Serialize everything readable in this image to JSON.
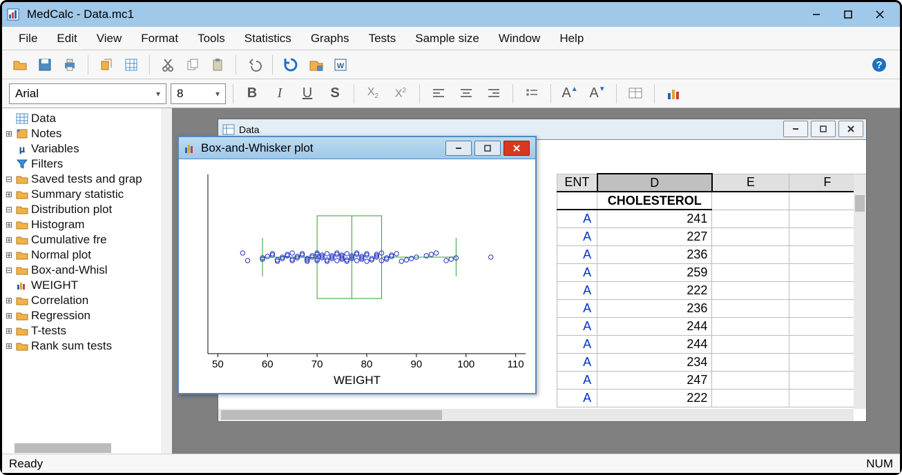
{
  "window": {
    "title": "MedCalc - Data.mc1"
  },
  "menu": [
    "File",
    "Edit",
    "View",
    "Format",
    "Tools",
    "Statistics",
    "Graphs",
    "Tests",
    "Sample size",
    "Window",
    "Help"
  ],
  "font": {
    "name": "Arial",
    "size": "8"
  },
  "tree": {
    "data": "Data",
    "notes": "Notes",
    "variables": "Variables",
    "filters": "Filters",
    "saved": "Saved tests and grap",
    "summary": "Summary statistic",
    "distplot": "Distribution plot",
    "hist": "Histogram",
    "cumfreq": "Cumulative fre",
    "normplot": "Normal plot",
    "boxw": "Box-and-Whisl",
    "weight": "WEIGHT",
    "corr": "Correlation",
    "regr": "Regression",
    "ttests": "T-tests",
    "ranksum": "Rank sum tests"
  },
  "datawin": {
    "title": "Data"
  },
  "sheet": {
    "cols": {
      "c_partial": "ENT",
      "d": "D",
      "e": "E",
      "f": "F"
    },
    "hdr_d": "CHOLESTEROL",
    "rows": [
      {
        "t": "A",
        "chol": "241"
      },
      {
        "t": "A",
        "chol": "227"
      },
      {
        "t": "A",
        "chol": "236"
      },
      {
        "t": "A",
        "chol": "259"
      },
      {
        "t": "A",
        "chol": "222"
      },
      {
        "t": "A",
        "chol": "236"
      },
      {
        "t": "A",
        "chol": "244"
      },
      {
        "t": "A",
        "chol": "244"
      },
      {
        "t": "A",
        "chol": "234"
      },
      {
        "t": "A",
        "chol": "247"
      },
      {
        "t": "A",
        "chol": "222"
      }
    ]
  },
  "plotwin": {
    "title": "Box-and-Whisker plot"
  },
  "chart_data": {
    "type": "boxplot",
    "xlabel": "WEIGHT",
    "x_ticks": [
      50,
      60,
      70,
      80,
      90,
      100,
      110
    ],
    "x_range": [
      48,
      112
    ],
    "box": {
      "q1": 70,
      "median": 77,
      "q3": 83,
      "whisker_low": 59,
      "whisker_high": 98
    },
    "outliers": [
      105
    ],
    "jitter_points": [
      55,
      56,
      59,
      59,
      60,
      61,
      61,
      62,
      62,
      63,
      63,
      64,
      64,
      65,
      65,
      65,
      66,
      66,
      67,
      67,
      68,
      68,
      68,
      69,
      69,
      70,
      70,
      70,
      70,
      71,
      71,
      71,
      72,
      72,
      72,
      73,
      73,
      73,
      74,
      74,
      74,
      75,
      75,
      75,
      75,
      76,
      76,
      76,
      77,
      77,
      77,
      78,
      78,
      78,
      79,
      79,
      79,
      80,
      80,
      80,
      81,
      81,
      82,
      82,
      82,
      83,
      83,
      84,
      84,
      85,
      85,
      86,
      87,
      88,
      89,
      90,
      92,
      93,
      94,
      96,
      97,
      98
    ]
  },
  "status": {
    "left": "Ready",
    "right": "NUM"
  }
}
